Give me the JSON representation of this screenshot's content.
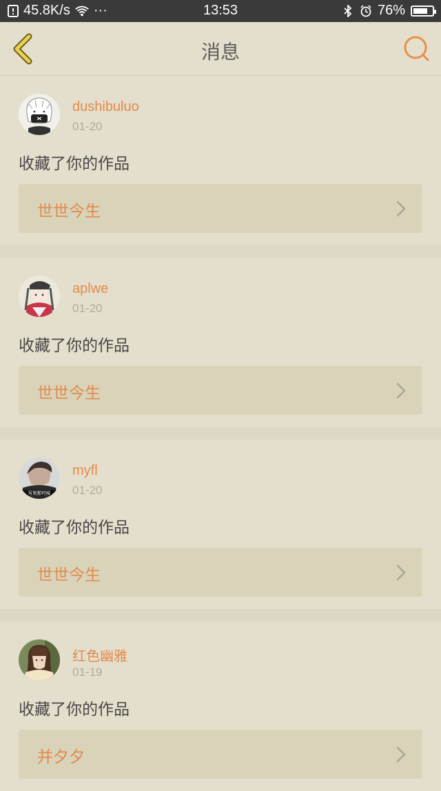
{
  "status_bar": {
    "speed": "45.8K/s",
    "dots": "···",
    "time": "13:53",
    "battery_percent": "76%",
    "battery_level": 0.76
  },
  "header": {
    "title": "消息"
  },
  "messages": [
    {
      "username": "dushibuluo",
      "date": "01-20",
      "action": "收藏了你的作品",
      "work_title": "世世今生",
      "avatar_icon": "avatar-masked-boy"
    },
    {
      "username": "aplwe",
      "date": "01-20",
      "action": "收藏了你的作品",
      "work_title": "世世今生",
      "avatar_icon": "avatar-kimono-girl"
    },
    {
      "username": "myfl",
      "date": "01-20",
      "action": "收藏了你的作品",
      "work_title": "世世今生",
      "avatar_icon": "avatar-photo-boy",
      "avatar_caption": "写到那时候"
    },
    {
      "username": "红色幽雅",
      "date": "01-19",
      "action": "收藏了你的作品",
      "work_title": "并夕夕",
      "avatar_icon": "avatar-photo-girl"
    }
  ],
  "colors": {
    "accent": "#e18a4d",
    "background": "#e4dfcc",
    "link_bg": "#d9d3ba"
  }
}
